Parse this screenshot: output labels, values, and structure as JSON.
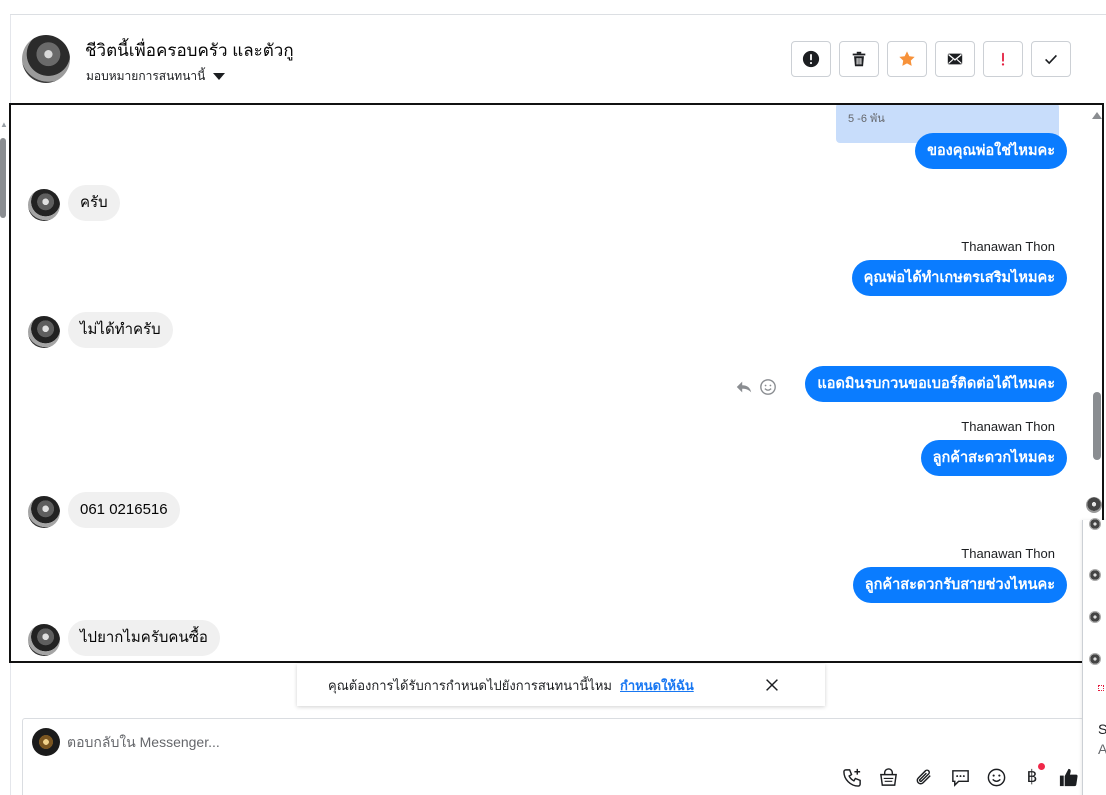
{
  "conversation": {
    "title": "ชีวิตนี้เพื่อครอบครัว และตัวกู",
    "assign_label": "มอบหมายการสนทนานี้"
  },
  "toolbar": {
    "buttons": [
      {
        "name": "mark-spam",
        "icon": "alert-circle-icon"
      },
      {
        "name": "delete",
        "icon": "trash-icon"
      },
      {
        "name": "star",
        "icon": "star-icon"
      },
      {
        "name": "mark-unread",
        "icon": "envelope-icon"
      },
      {
        "name": "follow-up",
        "icon": "exclamation-icon"
      },
      {
        "name": "mark-done",
        "icon": "check-icon"
      }
    ]
  },
  "messages": {
    "quoted_text": "5 -6 พัน",
    "m1": "ของคุณพ่อใช่ไหมคะ",
    "m2": "ครับ",
    "sender_1": "Thanawan Thon",
    "m3": "คุณพ่อได้ทำเกษตรเสริมไหมคะ",
    "m4": "ไม่ได้ทำครับ",
    "m5": "แอดมินรบกวนขอเบอร์ติดต่อได้ไหมคะ",
    "sender_2": "Thanawan Thon",
    "m6": "ลูกค้าสะดวกไหมคะ",
    "m7": "061 0216516",
    "sender_3": "Thanawan Thon",
    "m8": "ลูกค้าสะดวกรับสายช่วงไหนคะ",
    "m9": "ไปยากไมครับคนซื้อ"
  },
  "suggestion": {
    "text": "คุณต้องการได้รับการกำหนดไปยังการสนทนานี้ไหม",
    "link": "กำหนดให้ฉัน"
  },
  "composer": {
    "placeholder": "ตอบกลับใน Messenger...",
    "baht_glyph": "฿"
  },
  "side_panel": {
    "text_s": "S",
    "text_a": "A"
  },
  "colors": {
    "outgoing_bubble": "#0a7cff",
    "incoming_bubble": "#f0f0f0",
    "star": "#f7923a",
    "alert_red": "#e41e3f"
  }
}
